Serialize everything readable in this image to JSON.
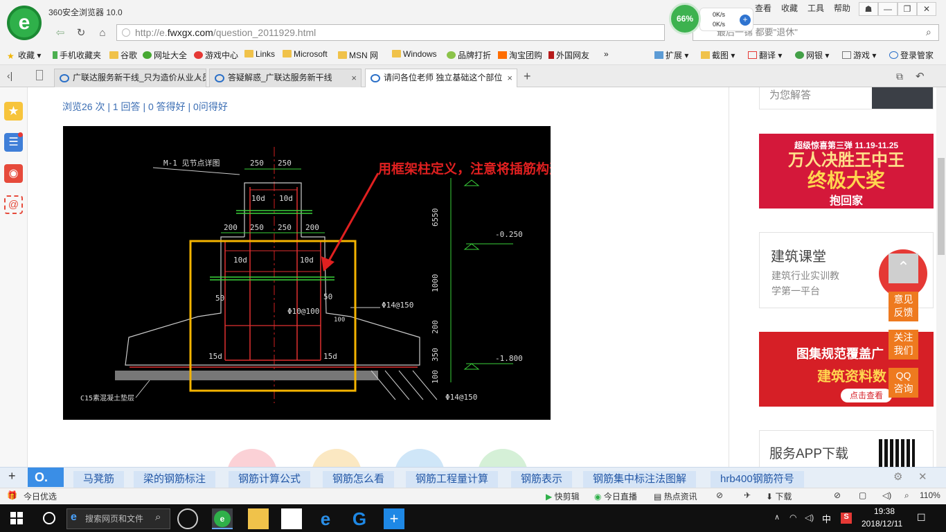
{
  "browser": {
    "app_title": "360安全浏览器 10.0",
    "menu": [
      "查看",
      "收藏",
      "工具",
      "帮助"
    ],
    "perf_percent": "66%",
    "net_up": "0K/s",
    "net_down": "0K/s",
    "url_prefix": "http://e.",
    "url_domain": "fwxgx.com",
    "url_path": "/question_2011929.html",
    "search_placeholder": "最后一锦 都要\"退休\"",
    "bookmarks": [
      {
        "label": "收藏"
      },
      {
        "label": "手机收藏夹"
      },
      {
        "label": "谷歌"
      },
      {
        "label": "网址大全"
      },
      {
        "label": "游戏中心"
      },
      {
        "label": "Links"
      },
      {
        "label": "Microsoft"
      },
      {
        "label": "MSN 网"
      },
      {
        "label": "Windows"
      },
      {
        "label": "品牌打折"
      },
      {
        "label": "淘宝团购"
      },
      {
        "label": "外国网友"
      },
      {
        "label": "»"
      }
    ],
    "extensions": [
      "扩展",
      "截图",
      "翻译",
      "网银",
      "游戏",
      "登录管家"
    ],
    "tabs": [
      {
        "label": "广联达服务新干线_只为造价从业人员"
      },
      {
        "label": "答疑解惑_广联达服务新干线"
      },
      {
        "label": "请问各位老师 独立基础这个部位"
      }
    ]
  },
  "page": {
    "stats": "浏览26 次 | 1 回答 | 0 答得好 | 0问得好",
    "annotation": "用框架柱定义，注意将插筋构造更改为“纵筋锚固”",
    "drawing": {
      "title": "M-1 见节点详图",
      "dims_top": [
        "250",
        "250"
      ],
      "dims_mid": [
        "200",
        "250",
        "250",
        "200"
      ],
      "labels_10d": [
        "10d",
        "10d",
        "10d",
        "10d"
      ],
      "labels_50": [
        "50",
        "50"
      ],
      "labels_15d": [
        "15d",
        "15d"
      ],
      "stirrup": "Φ10@100",
      "small_dim": "100",
      "side_bar": "Φ14@150",
      "bottom_bar": "Φ14@150",
      "elevations": [
        "-0.250",
        "-1.800"
      ],
      "vertical_dims": [
        "6550",
        "1000",
        "200",
        "350",
        "100"
      ],
      "base_label": "C15素混凝土垫层"
    },
    "side_top_text": "为您解答",
    "ad1": {
      "top": "超级惊喜第三弹",
      "dates": "11.19-11.25",
      "line1": "万人决胜王中王",
      "line2": "终极大奖",
      "line3": "抱回家"
    },
    "ad2": {
      "title": "建筑课堂",
      "line1": "建筑行业实训教",
      "line2": "学第一平台"
    },
    "ad3": {
      "line1": "图集规范覆盖广",
      "line2": "建筑资料数",
      "btn": "点击查看"
    },
    "ad4": {
      "title": "服务APP下载"
    },
    "float_buttons": [
      "意见反馈",
      "关注我们",
      "QQ咨询"
    ],
    "hotwords": [
      "马凳筋",
      "梁的钢筋标注",
      "钢筋计算公式",
      "钢筋怎么看",
      "钢筋工程量计算",
      "钢筋表示",
      "钢筋集中标注法图解",
      "hrb400钢筋符号"
    ]
  },
  "status": {
    "left": "今日优选",
    "items": [
      "快剪辑",
      "今日直播",
      "热点资讯",
      "下载"
    ],
    "zoom": "110%"
  },
  "taskbar": {
    "search": "搜索网页和文件",
    "ime": "中",
    "time": "19:38",
    "date": "2018/12/11"
  },
  "colors": {
    "accent": "#2fb04a",
    "annotation": "#e02020",
    "highlight": "#f5b400",
    "link": "#3a6db3"
  }
}
